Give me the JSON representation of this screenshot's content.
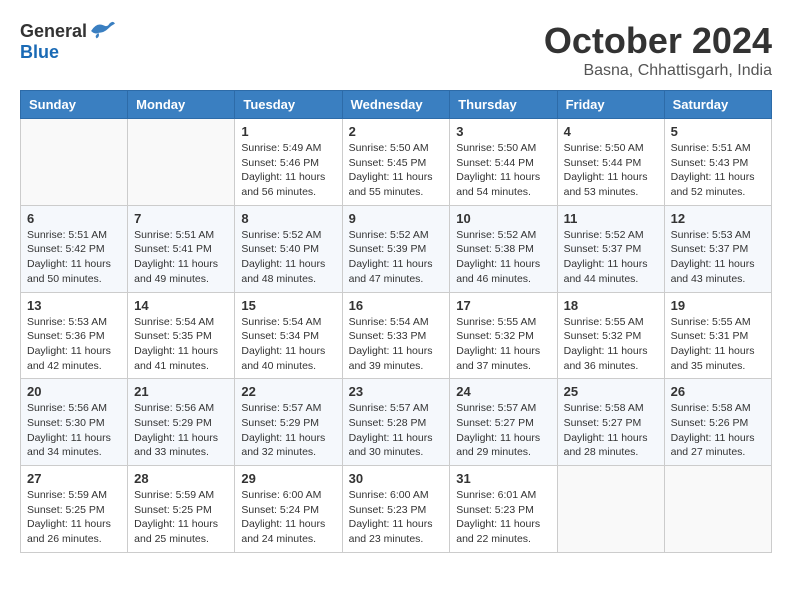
{
  "logo": {
    "general": "General",
    "blue": "Blue"
  },
  "title": "October 2024",
  "location": "Basna, Chhattisgarh, India",
  "days_of_week": [
    "Sunday",
    "Monday",
    "Tuesday",
    "Wednesday",
    "Thursday",
    "Friday",
    "Saturday"
  ],
  "weeks": [
    [
      {
        "day": "",
        "info": ""
      },
      {
        "day": "",
        "info": ""
      },
      {
        "day": "1",
        "info": "Sunrise: 5:49 AM\nSunset: 5:46 PM\nDaylight: 11 hours and 56 minutes."
      },
      {
        "day": "2",
        "info": "Sunrise: 5:50 AM\nSunset: 5:45 PM\nDaylight: 11 hours and 55 minutes."
      },
      {
        "day": "3",
        "info": "Sunrise: 5:50 AM\nSunset: 5:44 PM\nDaylight: 11 hours and 54 minutes."
      },
      {
        "day": "4",
        "info": "Sunrise: 5:50 AM\nSunset: 5:44 PM\nDaylight: 11 hours and 53 minutes."
      },
      {
        "day": "5",
        "info": "Sunrise: 5:51 AM\nSunset: 5:43 PM\nDaylight: 11 hours and 52 minutes."
      }
    ],
    [
      {
        "day": "6",
        "info": "Sunrise: 5:51 AM\nSunset: 5:42 PM\nDaylight: 11 hours and 50 minutes."
      },
      {
        "day": "7",
        "info": "Sunrise: 5:51 AM\nSunset: 5:41 PM\nDaylight: 11 hours and 49 minutes."
      },
      {
        "day": "8",
        "info": "Sunrise: 5:52 AM\nSunset: 5:40 PM\nDaylight: 11 hours and 48 minutes."
      },
      {
        "day": "9",
        "info": "Sunrise: 5:52 AM\nSunset: 5:39 PM\nDaylight: 11 hours and 47 minutes."
      },
      {
        "day": "10",
        "info": "Sunrise: 5:52 AM\nSunset: 5:38 PM\nDaylight: 11 hours and 46 minutes."
      },
      {
        "day": "11",
        "info": "Sunrise: 5:52 AM\nSunset: 5:37 PM\nDaylight: 11 hours and 44 minutes."
      },
      {
        "day": "12",
        "info": "Sunrise: 5:53 AM\nSunset: 5:37 PM\nDaylight: 11 hours and 43 minutes."
      }
    ],
    [
      {
        "day": "13",
        "info": "Sunrise: 5:53 AM\nSunset: 5:36 PM\nDaylight: 11 hours and 42 minutes."
      },
      {
        "day": "14",
        "info": "Sunrise: 5:54 AM\nSunset: 5:35 PM\nDaylight: 11 hours and 41 minutes."
      },
      {
        "day": "15",
        "info": "Sunrise: 5:54 AM\nSunset: 5:34 PM\nDaylight: 11 hours and 40 minutes."
      },
      {
        "day": "16",
        "info": "Sunrise: 5:54 AM\nSunset: 5:33 PM\nDaylight: 11 hours and 39 minutes."
      },
      {
        "day": "17",
        "info": "Sunrise: 5:55 AM\nSunset: 5:32 PM\nDaylight: 11 hours and 37 minutes."
      },
      {
        "day": "18",
        "info": "Sunrise: 5:55 AM\nSunset: 5:32 PM\nDaylight: 11 hours and 36 minutes."
      },
      {
        "day": "19",
        "info": "Sunrise: 5:55 AM\nSunset: 5:31 PM\nDaylight: 11 hours and 35 minutes."
      }
    ],
    [
      {
        "day": "20",
        "info": "Sunrise: 5:56 AM\nSunset: 5:30 PM\nDaylight: 11 hours and 34 minutes."
      },
      {
        "day": "21",
        "info": "Sunrise: 5:56 AM\nSunset: 5:29 PM\nDaylight: 11 hours and 33 minutes."
      },
      {
        "day": "22",
        "info": "Sunrise: 5:57 AM\nSunset: 5:29 PM\nDaylight: 11 hours and 32 minutes."
      },
      {
        "day": "23",
        "info": "Sunrise: 5:57 AM\nSunset: 5:28 PM\nDaylight: 11 hours and 30 minutes."
      },
      {
        "day": "24",
        "info": "Sunrise: 5:57 AM\nSunset: 5:27 PM\nDaylight: 11 hours and 29 minutes."
      },
      {
        "day": "25",
        "info": "Sunrise: 5:58 AM\nSunset: 5:27 PM\nDaylight: 11 hours and 28 minutes."
      },
      {
        "day": "26",
        "info": "Sunrise: 5:58 AM\nSunset: 5:26 PM\nDaylight: 11 hours and 27 minutes."
      }
    ],
    [
      {
        "day": "27",
        "info": "Sunrise: 5:59 AM\nSunset: 5:25 PM\nDaylight: 11 hours and 26 minutes."
      },
      {
        "day": "28",
        "info": "Sunrise: 5:59 AM\nSunset: 5:25 PM\nDaylight: 11 hours and 25 minutes."
      },
      {
        "day": "29",
        "info": "Sunrise: 6:00 AM\nSunset: 5:24 PM\nDaylight: 11 hours and 24 minutes."
      },
      {
        "day": "30",
        "info": "Sunrise: 6:00 AM\nSunset: 5:23 PM\nDaylight: 11 hours and 23 minutes."
      },
      {
        "day": "31",
        "info": "Sunrise: 6:01 AM\nSunset: 5:23 PM\nDaylight: 11 hours and 22 minutes."
      },
      {
        "day": "",
        "info": ""
      },
      {
        "day": "",
        "info": ""
      }
    ]
  ]
}
